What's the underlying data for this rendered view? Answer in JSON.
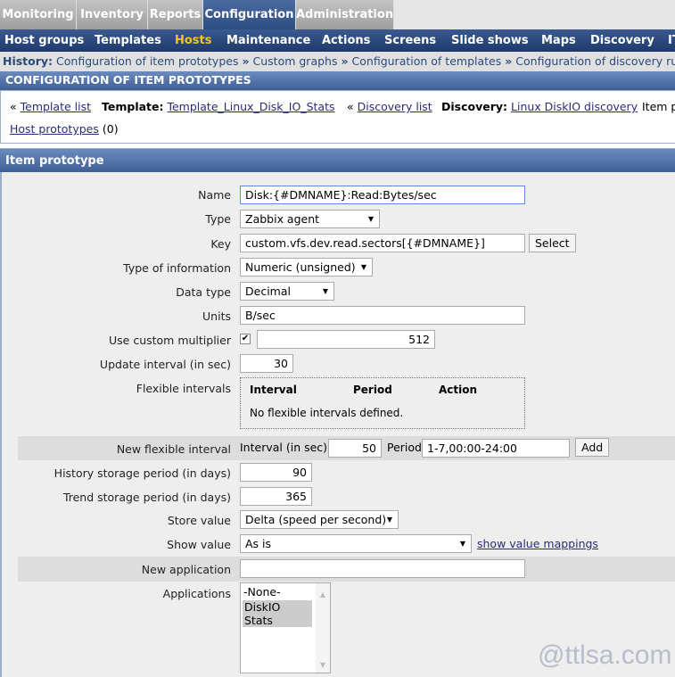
{
  "top_tabs": [
    "Monitoring",
    "Inventory",
    "Reports",
    "Configuration",
    "Administration"
  ],
  "active_tab": "Configuration",
  "nav": [
    "Host groups",
    "Templates",
    "Hosts",
    "Maintenance",
    "Actions",
    "Screens",
    "Slide shows",
    "Maps",
    "Discovery",
    "IT"
  ],
  "active_nav": "Hosts",
  "history": {
    "label": "History:",
    "items": [
      "Configuration of item prototypes",
      "Custom graphs",
      "Configuration of templates",
      "Configuration of discovery rules"
    ]
  },
  "page_title": "CONFIGURATION OF ITEM PROTOTYPES",
  "links": {
    "template_list": "Template list",
    "template_label": "Template:",
    "template": "Template_Linux_Disk_IO_Stats",
    "discovery_list": "Discovery list",
    "discovery_label": "Discovery:",
    "discovery": "Linux DiskIO discovery",
    "item_prototypes": "Item p",
    "host_prototypes": "Host prototypes",
    "host_prototypes_count": "(0)"
  },
  "section_title": "Item prototype",
  "form": {
    "name": {
      "label": "Name",
      "value": "Disk:{#DMNAME}:Read:Bytes/sec"
    },
    "type": {
      "label": "Type",
      "value": "Zabbix agent"
    },
    "key": {
      "label": "Key",
      "value": "custom.vfs.dev.read.sectors[{#DMNAME}]",
      "button": "Select"
    },
    "type_info": {
      "label": "Type of information",
      "value": "Numeric (unsigned)"
    },
    "data_type": {
      "label": "Data type",
      "value": "Decimal"
    },
    "units": {
      "label": "Units",
      "value": "B/sec"
    },
    "multiplier": {
      "label": "Use custom multiplier",
      "checked": true,
      "value": "512"
    },
    "update": {
      "label": "Update interval (in sec)",
      "value": "30"
    },
    "flex": {
      "label": "Flexible intervals",
      "cols": [
        "Interval",
        "Period",
        "Action"
      ],
      "empty": "No flexible intervals defined."
    },
    "new_flex": {
      "label": "New flexible interval",
      "interval_label": "Interval (in sec)",
      "interval": "50",
      "period_label": "Period",
      "period": "1-7,00:00-24:00",
      "button": "Add"
    },
    "history": {
      "label": "History storage period (in days)",
      "value": "90"
    },
    "trend": {
      "label": "Trend storage period (in days)",
      "value": "365"
    },
    "store": {
      "label": "Store value",
      "value": "Delta (speed per second)"
    },
    "show": {
      "label": "Show value",
      "value": "As is",
      "link": "show value mappings"
    },
    "new_app": {
      "label": "New application",
      "value": ""
    },
    "apps": {
      "label": "Applications",
      "options": [
        "-None-",
        "DiskIO Stats"
      ],
      "selected": "DiskIO Stats"
    }
  },
  "watermark": "@ttlsa.com"
}
